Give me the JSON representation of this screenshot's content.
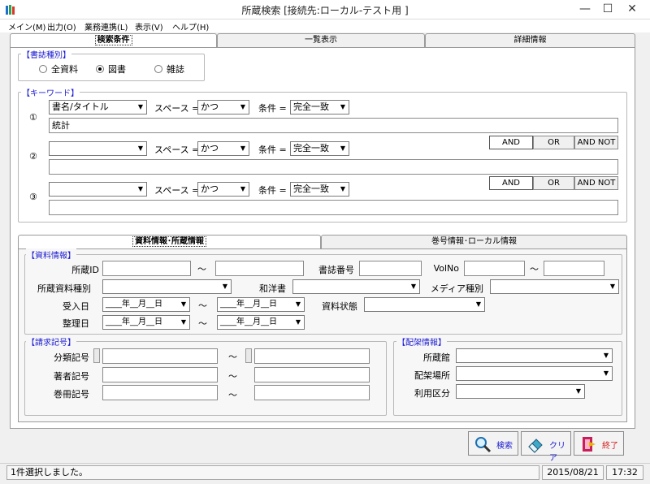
{
  "window": {
    "title": "所蔵検索 [接続先:ローカル-テスト用 ]",
    "min_glyph": "—",
    "max_glyph": "☐",
    "close_glyph": "✕"
  },
  "menu": [
    "メイン(M)",
    "出力(O)",
    "業務連携(L)",
    "表示(V)",
    "ヘルプ(H)"
  ],
  "tabs_top": [
    "検索条件",
    "一覧表示",
    "詳細情報"
  ],
  "material_type": {
    "label": "【書誌種別】",
    "options": [
      "全資料",
      "図書",
      "雑誌"
    ],
    "selected": "図書"
  },
  "keyword": {
    "label": "【キーワード】",
    "space_label": "スペース =",
    "cond_label": "条件 =",
    "rows": [
      {
        "num": "①",
        "field": "書名/タイトル",
        "space": "かつ",
        "cond": "完全一致",
        "value": "統計"
      },
      {
        "num": "②",
        "field": "",
        "space": "かつ",
        "cond": "完全一致",
        "value": ""
      },
      {
        "num": "③",
        "field": "",
        "space": "かつ",
        "cond": "完全一致",
        "value": ""
      }
    ],
    "ops": [
      "AND",
      "OR",
      "AND NOT"
    ],
    "selected_op": "AND"
  },
  "tabs_bottom": [
    "資料情報･所蔵情報",
    "巻号情報･ローカル情報"
  ],
  "doc_info": {
    "label": "【資料情報】",
    "holding_id": "所蔵ID",
    "tilde": "～",
    "biblio_no": "書誌番号",
    "volno": "VolNo",
    "holding_type": "所蔵資料種別",
    "jp_west": "和洋書",
    "media_type": "メディア種別",
    "received": "受入日",
    "arranged": "整理日",
    "date_placeholder": "____年__月__日",
    "status": "資料状態"
  },
  "call_no": {
    "label": "【請求記号】",
    "class_no": "分類記号",
    "author_no": "著者記号",
    "volume_no": "巻冊記号"
  },
  "shelf": {
    "label": "【配架情報】",
    "library": "所蔵館",
    "location": "配架場所",
    "usage": "利用区分"
  },
  "buttons": {
    "search": "検索",
    "clear": "クリア",
    "exit": "終了"
  },
  "status": {
    "message": "1件選択しました。",
    "date": "2015/08/21",
    "time": "17:32"
  }
}
